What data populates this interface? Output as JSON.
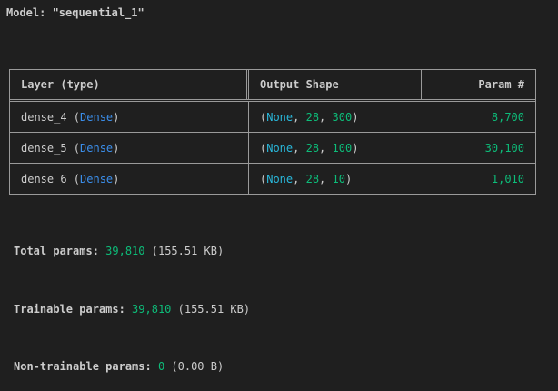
{
  "model": {
    "prefix": "Model: ",
    "name": "\"sequential_1\""
  },
  "table": {
    "headers": {
      "layer": "Layer (type)",
      "shape": "Output Shape",
      "params": "Param #"
    },
    "rows": [
      {
        "name": "dense_4",
        "type": "Dense",
        "shape_prefix": "None",
        "dim1": "28",
        "dim2": "300",
        "params": "8,700"
      },
      {
        "name": "dense_5",
        "type": "Dense",
        "shape_prefix": "None",
        "dim1": "28",
        "dim2": "100",
        "params": "30,100"
      },
      {
        "name": "dense_6",
        "type": "Dense",
        "shape_prefix": "None",
        "dim1": "28",
        "dim2": "10",
        "params": "1,010"
      }
    ]
  },
  "stats": {
    "total": {
      "label": "Total params: ",
      "value": "39,810",
      "size": " (155.51 KB)"
    },
    "trainable": {
      "label": "Trainable params: ",
      "value": "39,810",
      "size": " (155.51 KB)"
    },
    "non_trainable": {
      "label": "Non-trainable params: ",
      "value": "0",
      "size": " (0.00 B)"
    }
  },
  "colors": {
    "background": "#1f1f1f",
    "text": "#cccccc",
    "type_blue": "#3b8eea",
    "none_cyan": "#29b8db",
    "number_green": "#0dbc79",
    "border": "#9a9a9a"
  }
}
